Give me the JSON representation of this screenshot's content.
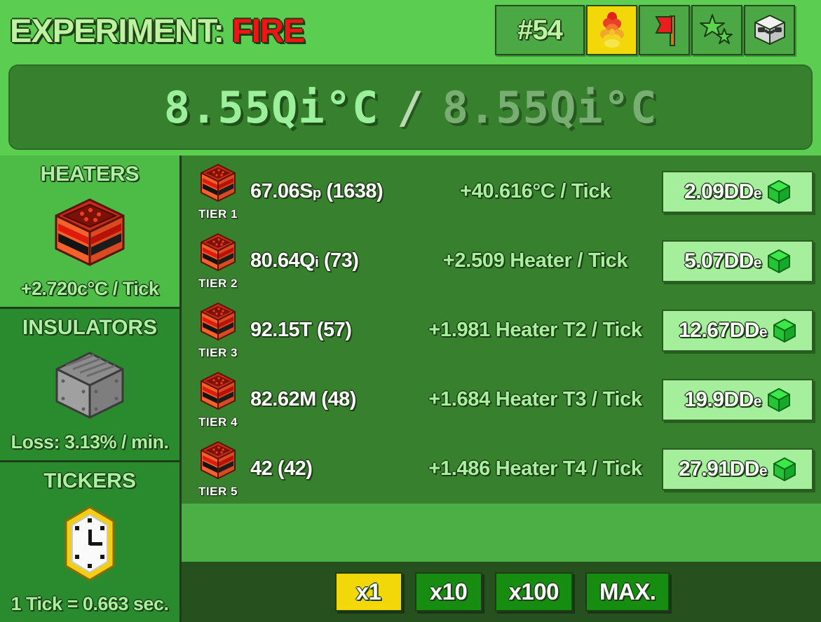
{
  "header": {
    "title_prefix": "EXPERIMENT: ",
    "title_suffix": "FIRE",
    "experiment_badge": "#54",
    "tabs": [
      {
        "name": "fire-tab",
        "icon": "fire-icon",
        "active": true
      },
      {
        "name": "flag-tab",
        "icon": "red-flag-icon",
        "active": false
      },
      {
        "name": "stars-tab",
        "icon": "stars-icon",
        "active": false
      },
      {
        "name": "cube-tab",
        "icon": "white-cube-icon",
        "active": false
      }
    ]
  },
  "temperature": {
    "current": "8.55Qi°C",
    "separator": "/",
    "maximum": "8.55Qi°C"
  },
  "sidebar": {
    "panels": [
      {
        "title": "HEATERS",
        "icon": "heater-block-icon",
        "stat": "+2.720c°C / Tick",
        "selected": true
      },
      {
        "title": "INSULATORS",
        "icon": "insulator-block-icon",
        "stat": "Loss: 3.13% / min.",
        "selected": false
      },
      {
        "title": "TICKERS",
        "icon": "clock-icon",
        "stat": "1 Tick = 0.663 sec.",
        "selected": false
      }
    ]
  },
  "rows": [
    {
      "tier": "TIER 1",
      "icon": "heater-block-icon",
      "count_value": "67.06S",
      "count_suffix": "p",
      "count_owned": " (1638)",
      "effect": "+40.616°C / Tick",
      "cost_value": "2.09DD",
      "cost_suffix": "e",
      "currency_icon": "green-cube-icon"
    },
    {
      "tier": "TIER 2",
      "icon": "heater-block-icon",
      "count_value": "80.64Q",
      "count_suffix": "i",
      "count_owned": " (73)",
      "effect": "+2.509 Heater / Tick",
      "cost_value": "5.07DD",
      "cost_suffix": "e",
      "currency_icon": "green-cube-icon"
    },
    {
      "tier": "TIER 3",
      "icon": "heater-block-icon",
      "count_value": "92.15T",
      "count_suffix": "",
      "count_owned": " (57)",
      "effect": "+1.981 Heater T2 / Tick",
      "cost_value": "12.67DD",
      "cost_suffix": "e",
      "currency_icon": "green-cube-icon"
    },
    {
      "tier": "TIER 4",
      "icon": "heater-block-icon",
      "count_value": "82.62M",
      "count_suffix": "",
      "count_owned": " (48)",
      "effect": "+1.684 Heater T3 / Tick",
      "cost_value": "19.9DD",
      "cost_suffix": "e",
      "currency_icon": "green-cube-icon"
    },
    {
      "tier": "TIER 5",
      "icon": "heater-block-icon",
      "count_value": "42",
      "count_suffix": "",
      "count_owned": " (42)",
      "effect": "+1.486 Heater T4 / Tick",
      "cost_value": "27.91DD",
      "cost_suffix": "e",
      "currency_icon": "green-cube-icon"
    }
  ],
  "multipliers": [
    {
      "label": "x1",
      "active": true
    },
    {
      "label": "x10",
      "active": false
    },
    {
      "label": "x100",
      "active": false
    },
    {
      "label": "MAX.",
      "active": false
    }
  ],
  "colors": {
    "header_bg": "#5BCE52",
    "panel_dark": "#37802E",
    "panel_selected": "#4CBC47",
    "panel_side": "#2A8A2E",
    "bottom_bar": "#27501F",
    "accent_yellow": "#F2D808",
    "text_light_green": "#A8F09E",
    "fire_red": "#F21313",
    "cost_btn_bg": "#A5EE9B",
    "mult_btn_bg": "#168C10"
  }
}
